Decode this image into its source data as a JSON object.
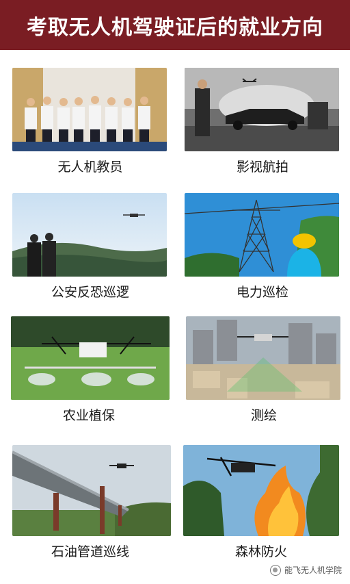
{
  "header": {
    "title": "考取无人机驾驶证后的就业方向"
  },
  "cards": [
    {
      "caption": "无人机教员"
    },
    {
      "caption": "影视航拍"
    },
    {
      "caption": "公安反恐巡逻"
    },
    {
      "caption": "电力巡检"
    },
    {
      "caption": "农业植保"
    },
    {
      "caption": "测绘"
    },
    {
      "caption": "石油管道巡线"
    },
    {
      "caption": "森林防火"
    }
  ],
  "watermark": {
    "text": "能飞无人机学院",
    "icon": "wechat-logo-icon"
  },
  "colors": {
    "header_bg": "#7a1d23",
    "header_text": "#ffffff"
  }
}
